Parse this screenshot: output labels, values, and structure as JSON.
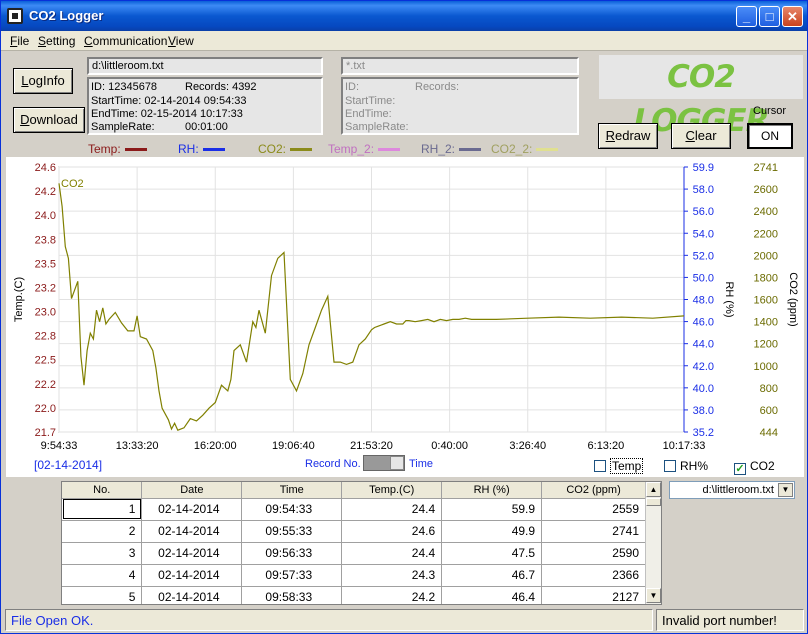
{
  "window": {
    "title": "CO2 Logger",
    "minimize": "_",
    "maximize": "□",
    "close": "✕"
  },
  "menu": [
    "File",
    "Setting",
    "Communication",
    "View"
  ],
  "buttons": {
    "loginfo": "LogInfo",
    "download": "Download",
    "redraw": "Redraw",
    "clear": "Clear"
  },
  "file1": {
    "path": "d:\\littleroom.txt",
    "id": "ID: 12345678",
    "records": "Records: 4392",
    "start": "StartTime: 02-14-2014 09:54:33",
    "end": "EndTime:  02-15-2014 10:17:33",
    "rate": "SampleRate:",
    "rate_value": "00:01:00"
  },
  "file2": {
    "path": "*.txt",
    "id": "ID:",
    "records": "Records:",
    "start": "StartTime:",
    "end": "EndTime:",
    "rate": "SampleRate:"
  },
  "logo": "CO2 LOGGER",
  "cursor": {
    "label": "Cursor",
    "value": "ON"
  },
  "legend": [
    {
      "label": "Temp:",
      "color": "#8b1a1a"
    },
    {
      "label": "RH:",
      "color": "#1a2ee6"
    },
    {
      "label": "CO2:",
      "color": "#8b8b1a"
    },
    {
      "label": "Temp_2:",
      "color": "#dd88dd"
    },
    {
      "label": "RH_2:",
      "color": "#6a6a90"
    },
    {
      "label": "CO2_2:",
      "color": "#e0e090"
    }
  ],
  "chart_data": {
    "type": "line",
    "series": [
      {
        "name": "CO2",
        "color": "#808000",
        "x": [
          0,
          0.005,
          0.01,
          0.015,
          0.02,
          0.03,
          0.035,
          0.04,
          0.045,
          0.05,
          0.055,
          0.06,
          0.065,
          0.07,
          0.075,
          0.08,
          0.09,
          0.1,
          0.11,
          0.12,
          0.125,
          0.13,
          0.14,
          0.15,
          0.155,
          0.16,
          0.165,
          0.175,
          0.18,
          0.185,
          0.19,
          0.2,
          0.21,
          0.22,
          0.23,
          0.24,
          0.25,
          0.26,
          0.27,
          0.275,
          0.28,
          0.29,
          0.3,
          0.31,
          0.315,
          0.32,
          0.33,
          0.34,
          0.35,
          0.36,
          0.37,
          0.38,
          0.39,
          0.4,
          0.41,
          0.42,
          0.43,
          0.44,
          0.45,
          0.46,
          0.47,
          0.48,
          0.49,
          0.5,
          0.505,
          0.51,
          0.52,
          0.53,
          0.54,
          0.55,
          0.555,
          0.56,
          0.57,
          0.58,
          0.59,
          0.6,
          0.61,
          0.62,
          0.63,
          0.64,
          0.65,
          0.66,
          0.7,
          0.75,
          0.8,
          0.85,
          0.9,
          0.95,
          1.0
        ],
        "y": [
          2600,
          2400,
          2050,
          1950,
          1600,
          1750,
          1100,
          850,
          1150,
          1300,
          1250,
          1500,
          1400,
          1520,
          1380,
          1420,
          1480,
          1390,
          1320,
          1320,
          1450,
          1270,
          1250,
          1150,
          1000,
          800,
          650,
          550,
          470,
          520,
          460,
          480,
          560,
          540,
          590,
          650,
          700,
          850,
          800,
          900,
          1150,
          1200,
          1050,
          1400,
          1350,
          1500,
          1300,
          1800,
          1950,
          2000,
          900,
          800,
          950,
          1200,
          1350,
          1500,
          1620,
          1050,
          1050,
          1030,
          1050,
          1200,
          1250,
          1330,
          1350,
          1360,
          1380,
          1400,
          1380,
          1380,
          1410,
          1410,
          1400,
          1410,
          1420,
          1400,
          1420,
          1410,
          1420,
          1420,
          1430,
          1420,
          1420,
          1430,
          1440,
          1430,
          1440,
          1430,
          1450
        ]
      }
    ],
    "x_ticks": [
      "9:54:33",
      "13:33:20",
      "16:20:00",
      "19:06:40",
      "21:53:20",
      "0:40:00",
      "3:26:40",
      "6:13:20",
      "10:17:33"
    ],
    "y_left": {
      "label": "Temp.(C)",
      "ticks": [
        "24.6",
        "24.2",
        "24.0",
        "23.8",
        "23.5",
        "23.2",
        "23.0",
        "22.8",
        "22.5",
        "22.2",
        "22.0",
        "21.7"
      ],
      "color": "#8b1a1a"
    },
    "y_right1": {
      "label": "RH (%)",
      "ticks": [
        "59.9",
        "58.0",
        "56.0",
        "54.0",
        "52.0",
        "50.0",
        "48.0",
        "46.0",
        "44.0",
        "42.0",
        "40.0",
        "38.0",
        "35.2"
      ],
      "color": "#1a2ee6"
    },
    "y_right2": {
      "label": "CO2 (ppm)",
      "ticks": [
        "2741",
        "2600",
        "2400",
        "2200",
        "2000",
        "1800",
        "1600",
        "1400",
        "1200",
        "1000",
        "800",
        "600",
        "444"
      ],
      "color": "#6b6b00"
    },
    "ylim_co2": [
      444,
      2741
    ],
    "series_label": "CO2",
    "grid": true
  },
  "chart_footer": {
    "date": "[02-14-2014]",
    "record_no": "Record No.",
    "time": "Time"
  },
  "checkboxes": [
    {
      "label": "Temp",
      "checked": false
    },
    {
      "label": "RH%",
      "checked": false
    },
    {
      "label": "CO2",
      "checked": true
    }
  ],
  "table": {
    "headers": [
      "No.",
      "Date",
      "Time",
      "Temp.(C)",
      "RH (%)",
      "CO2 (ppm)"
    ],
    "rows": [
      [
        "1",
        "02-14-2014",
        "09:54:33",
        "24.4",
        "59.9",
        "2559"
      ],
      [
        "2",
        "02-14-2014",
        "09:55:33",
        "24.6",
        "49.9",
        "2741"
      ],
      [
        "3",
        "02-14-2014",
        "09:56:33",
        "24.4",
        "47.5",
        "2590"
      ],
      [
        "4",
        "02-14-2014",
        "09:57:33",
        "24.3",
        "46.7",
        "2366"
      ],
      [
        "5",
        "02-14-2014",
        "09:58:33",
        "24.2",
        "46.4",
        "2127"
      ]
    ]
  },
  "file_select": "d:\\littleroom.txt",
  "status": {
    "left": "File Open OK.",
    "right": "Invalid port number!"
  }
}
